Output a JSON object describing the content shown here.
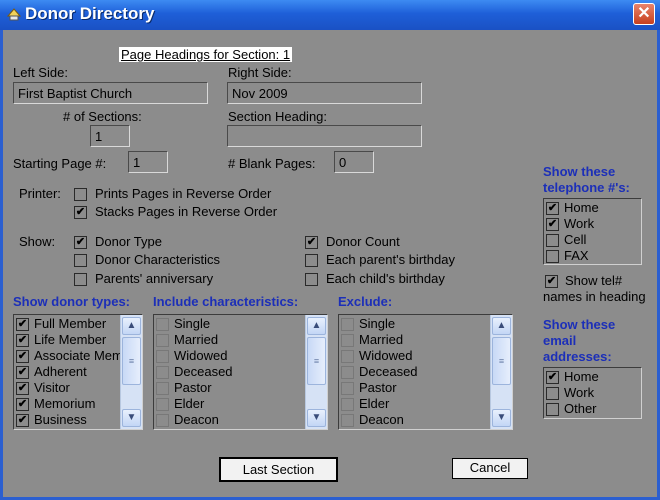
{
  "window": {
    "title": "Donor Directory",
    "close_label": "✕"
  },
  "section_heading_caption": "Page Headings for Section: 1",
  "left_side": {
    "label": "Left Side:",
    "value": "First Baptist Church"
  },
  "right_side": {
    "label": "Right Side:",
    "value": "Nov 2009"
  },
  "sections": {
    "label": "# of Sections:",
    "value": "1"
  },
  "section_heading": {
    "label": "Section Heading:",
    "value": ""
  },
  "starting_page": {
    "label": "Starting Page #:",
    "value": "1"
  },
  "blank_pages": {
    "label": "# Blank Pages:",
    "value": "0"
  },
  "printer": {
    "label": "Printer:",
    "options": [
      {
        "label": "Prints Pages in Reverse Order",
        "checked": false
      },
      {
        "label": "Stacks Pages in Reverse Order",
        "checked": true
      }
    ]
  },
  "show": {
    "label": "Show:",
    "left": [
      {
        "label": "Donor Type",
        "checked": true
      },
      {
        "label": "Donor Characteristics",
        "checked": false
      },
      {
        "label": "Parents' anniversary",
        "checked": false
      }
    ],
    "right": [
      {
        "label": "Donor Count",
        "checked": true
      },
      {
        "label": "Each parent's birthday",
        "checked": false
      },
      {
        "label": "Each child's birthday",
        "checked": false
      }
    ]
  },
  "donor_types": {
    "label": "Show donor types:",
    "items": [
      {
        "label": "Full Member",
        "checked": true
      },
      {
        "label": "Life Member",
        "checked": true
      },
      {
        "label": "Associate Member",
        "checked": true
      },
      {
        "label": "Adherent",
        "checked": true
      },
      {
        "label": "Visitor",
        "checked": true
      },
      {
        "label": "Memorium",
        "checked": true
      },
      {
        "label": "Business",
        "checked": true
      }
    ]
  },
  "characteristics": {
    "label": "Include characteristics:",
    "items": [
      "Single",
      "Married",
      "Widowed",
      "Deceased",
      "Pastor",
      "Elder",
      "Deacon"
    ]
  },
  "exclude": {
    "label": "Exclude:",
    "items": [
      "Single",
      "Married",
      "Widowed",
      "Deceased",
      "Pastor",
      "Elder",
      "Deacon"
    ]
  },
  "telephone": {
    "label_line1": "Show these",
    "label_line2": "telephone #'s:",
    "items": [
      {
        "label": "Home",
        "checked": true
      },
      {
        "label": "Work",
        "checked": true
      },
      {
        "label": "Cell",
        "checked": false
      },
      {
        "label": "FAX",
        "checked": false
      }
    ]
  },
  "tel_names": {
    "line1": "Show tel#",
    "line2": "names in heading",
    "checked": true
  },
  "email": {
    "label_line1": "Show these",
    "label_line2": "email",
    "label_line3": "addresses:",
    "items": [
      {
        "label": "Home",
        "checked": true
      },
      {
        "label": "Work",
        "checked": false
      },
      {
        "label": "Other",
        "checked": false
      }
    ]
  },
  "buttons": {
    "last_section": "Last Section",
    "cancel": "Cancel"
  }
}
